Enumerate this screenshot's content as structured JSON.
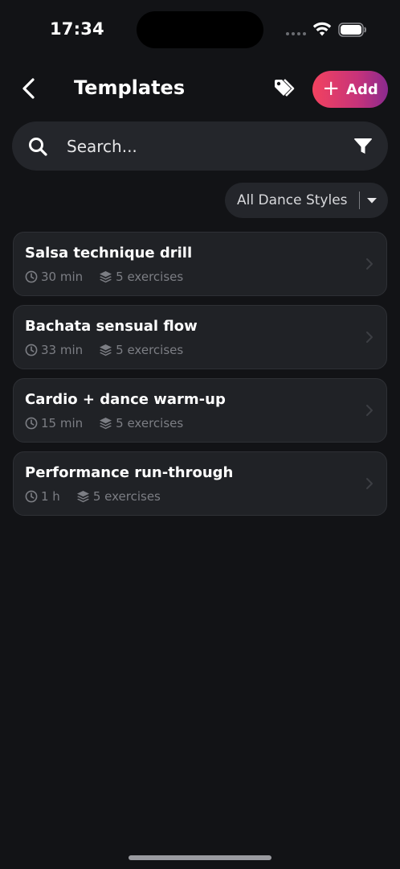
{
  "status_bar": {
    "time": "17:34"
  },
  "header": {
    "title": "Templates",
    "add_label": "Add",
    "add_symbol": "+"
  },
  "search": {
    "placeholder": "Search...",
    "value": ""
  },
  "filter": {
    "dance_style_selected": "All Dance Styles"
  },
  "templates": [
    {
      "title": "Salsa technique drill",
      "duration": "30 min",
      "exercises": "5 exercises"
    },
    {
      "title": "Bachata sensual flow",
      "duration": "33 min",
      "exercises": "5 exercises"
    },
    {
      "title": "Cardio + dance warm-up",
      "duration": "15 min",
      "exercises": "5 exercises"
    },
    {
      "title": "Performance run-through",
      "duration": "1 h",
      "exercises": "5 exercises"
    }
  ],
  "icons": {
    "back": "chevron-left-icon",
    "tags": "tags-icon",
    "search": "search-icon",
    "filter": "filter-icon",
    "dropdown": "caret-down-icon",
    "duration": "clock-icon",
    "exercises": "stack-icon",
    "row_action": "chevron-right-icon"
  },
  "colors": {
    "background": "#121316",
    "surface": "#24262b",
    "card": "#202226",
    "accent_start": "#f2425f",
    "accent_end": "#8a2a8f",
    "muted_text": "#7c7e84"
  }
}
